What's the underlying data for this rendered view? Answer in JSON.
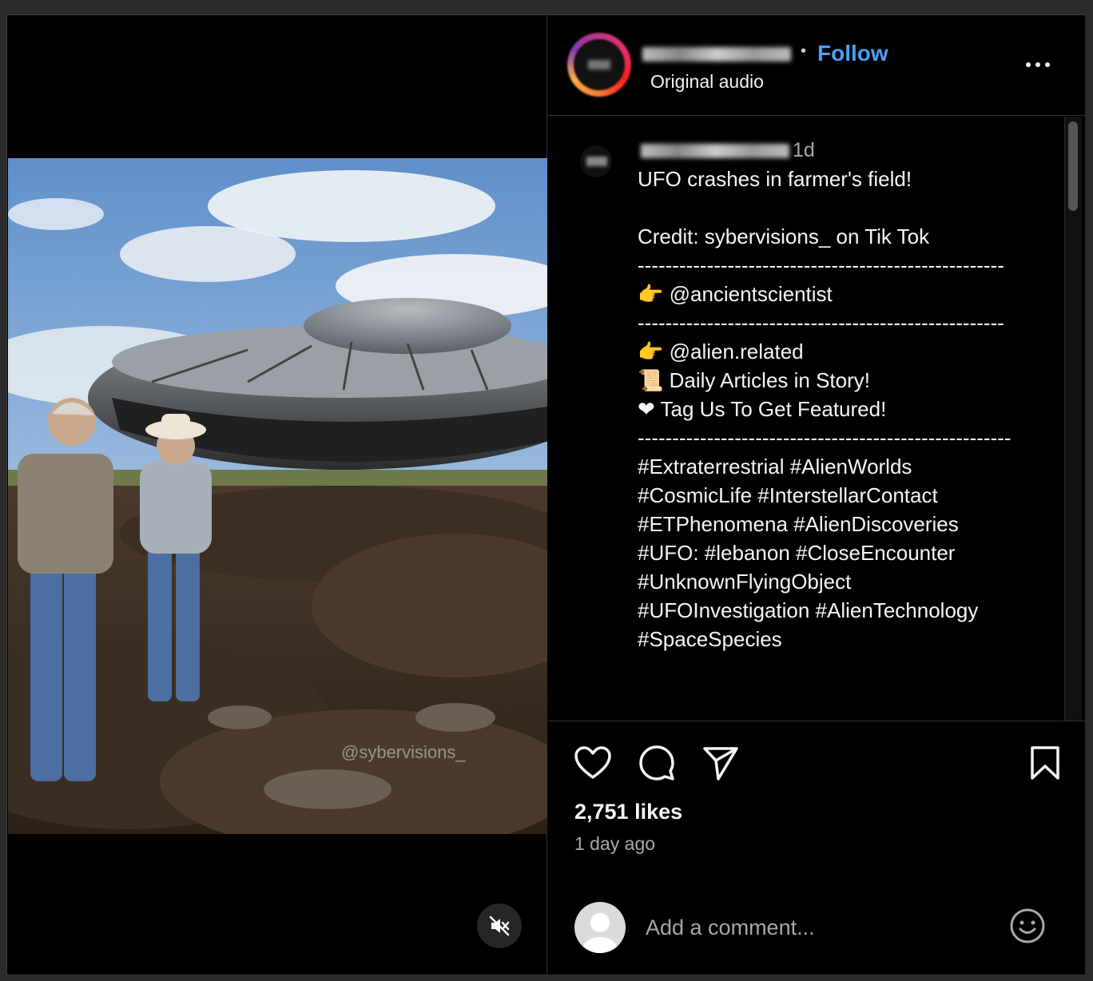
{
  "post": {
    "follow_label": "Follow",
    "audio_label": "Original audio",
    "time_ago_short": "1d",
    "watermark": "@sybervisions_"
  },
  "caption": {
    "lines": [
      "UFO crashes in farmer's field!",
      "",
      "Credit: sybervisions_ on Tik Tok",
      "-----------------------------------------------------",
      "👉 @ancientscientist",
      "-----------------------------------------------------",
      "👉 @alien.related",
      "📜 Daily Articles in Story!",
      "❤ Tag Us To Get Featured!",
      "------------------------------------------------------",
      "#Extraterrestrial #AlienWorlds",
      "#CosmicLife #InterstellarContact",
      "#ETPhenomena #AlienDiscoveries",
      "#UFO: #lebanon #CloseEncounter",
      "#UnknownFlyingObject",
      "#UFOInvestigation #AlienTechnology",
      "#SpaceSpecies"
    ]
  },
  "stats": {
    "likes": "2,751 likes",
    "posted": "1 day ago"
  },
  "comment": {
    "placeholder": "Add a comment..."
  },
  "icons": {
    "mute": "speaker-muted-icon",
    "more": "more-options-icon",
    "like": "heart-icon",
    "comment": "comment-bubble-icon",
    "share": "paper-plane-icon",
    "save": "bookmark-icon",
    "emoji": "smiley-icon"
  },
  "colors": {
    "background": "#000000",
    "link": "#4a9ff5",
    "muted_text": "#a8a8a8"
  }
}
